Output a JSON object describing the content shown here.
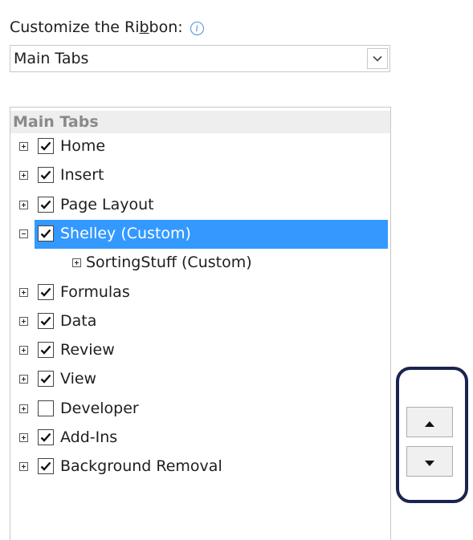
{
  "heading": {
    "before": "Customize the Ri",
    "underlined": "b",
    "after": "bon:",
    "info_icon": "info-icon"
  },
  "dropdown": {
    "value": "Main Tabs",
    "icon": "chevron-down-icon"
  },
  "tree": {
    "header": "Main Tabs",
    "items": [
      {
        "label": "Home",
        "checked": true,
        "level": 0,
        "expander": "plus"
      },
      {
        "label": "Insert",
        "checked": true,
        "level": 0,
        "expander": "plus"
      },
      {
        "label": "Page Layout",
        "checked": true,
        "level": 0,
        "expander": "plus"
      },
      {
        "label": "Shelley (Custom)",
        "checked": true,
        "level": 0,
        "expander": "minus",
        "selected": true
      },
      {
        "label": "SortingStuff (Custom)",
        "checked": null,
        "level": 1,
        "expander": "plus"
      },
      {
        "label": "Formulas",
        "checked": true,
        "level": 0,
        "expander": "plus"
      },
      {
        "label": "Data",
        "checked": true,
        "level": 0,
        "expander": "plus"
      },
      {
        "label": "Review",
        "checked": true,
        "level": 0,
        "expander": "plus"
      },
      {
        "label": "View",
        "checked": true,
        "level": 0,
        "expander": "plus"
      },
      {
        "label": "Developer",
        "checked": false,
        "level": 0,
        "expander": "plus"
      },
      {
        "label": "Add-Ins",
        "checked": true,
        "level": 0,
        "expander": "plus"
      },
      {
        "label": "Background Removal",
        "checked": true,
        "level": 0,
        "expander": "plus"
      }
    ]
  },
  "move_buttons": {
    "up_icon": "triangle-up-icon",
    "down_icon": "triangle-down-icon"
  },
  "colors": {
    "selection": "#3399ff",
    "callout_border": "#1b2450",
    "header_bg": "#eeeeee"
  }
}
